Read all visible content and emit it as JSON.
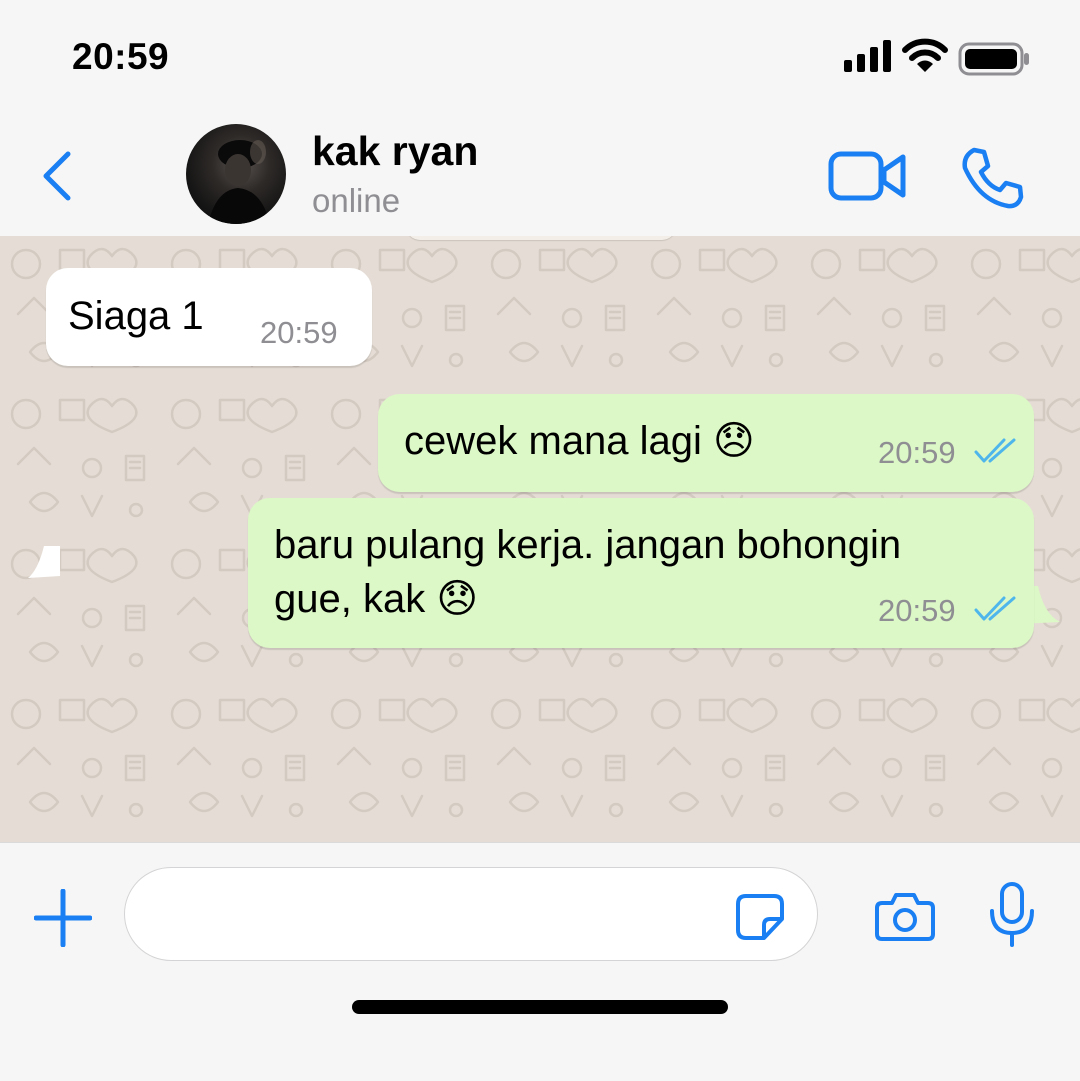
{
  "status_bar": {
    "time": "20:59",
    "icons": [
      "signal-icon",
      "wifi-icon",
      "battery-icon"
    ]
  },
  "header": {
    "back_icon": "chevron-left-icon",
    "contact_name": "kak ryan",
    "contact_status": "online",
    "actions": [
      "video-call-icon",
      "voice-call-icon"
    ]
  },
  "messages": [
    {
      "direction": "incoming",
      "text": "Siaga 1",
      "time": "20:59"
    },
    {
      "direction": "outgoing",
      "text": "cewek mana lagi 😞",
      "time": "20:59",
      "read": true
    },
    {
      "direction": "outgoing",
      "text_line1": "baru pulang kerja. jangan bohongin",
      "text_line2": "gue, kak 😞",
      "time": "20:59",
      "read": true
    }
  ],
  "composer": {
    "value": "",
    "placeholder": "",
    "icons": [
      "plus-icon",
      "sticker-icon",
      "camera-icon",
      "mic-icon"
    ]
  },
  "colors": {
    "accent": "#1a7ff2",
    "outgoing_bubble": "#dcf8c6",
    "incoming_bubble": "#ffffff",
    "wallpaper": "#e5ddd5",
    "read_ticks": "#4fb6ec",
    "timestamp": "#8e8e93"
  }
}
